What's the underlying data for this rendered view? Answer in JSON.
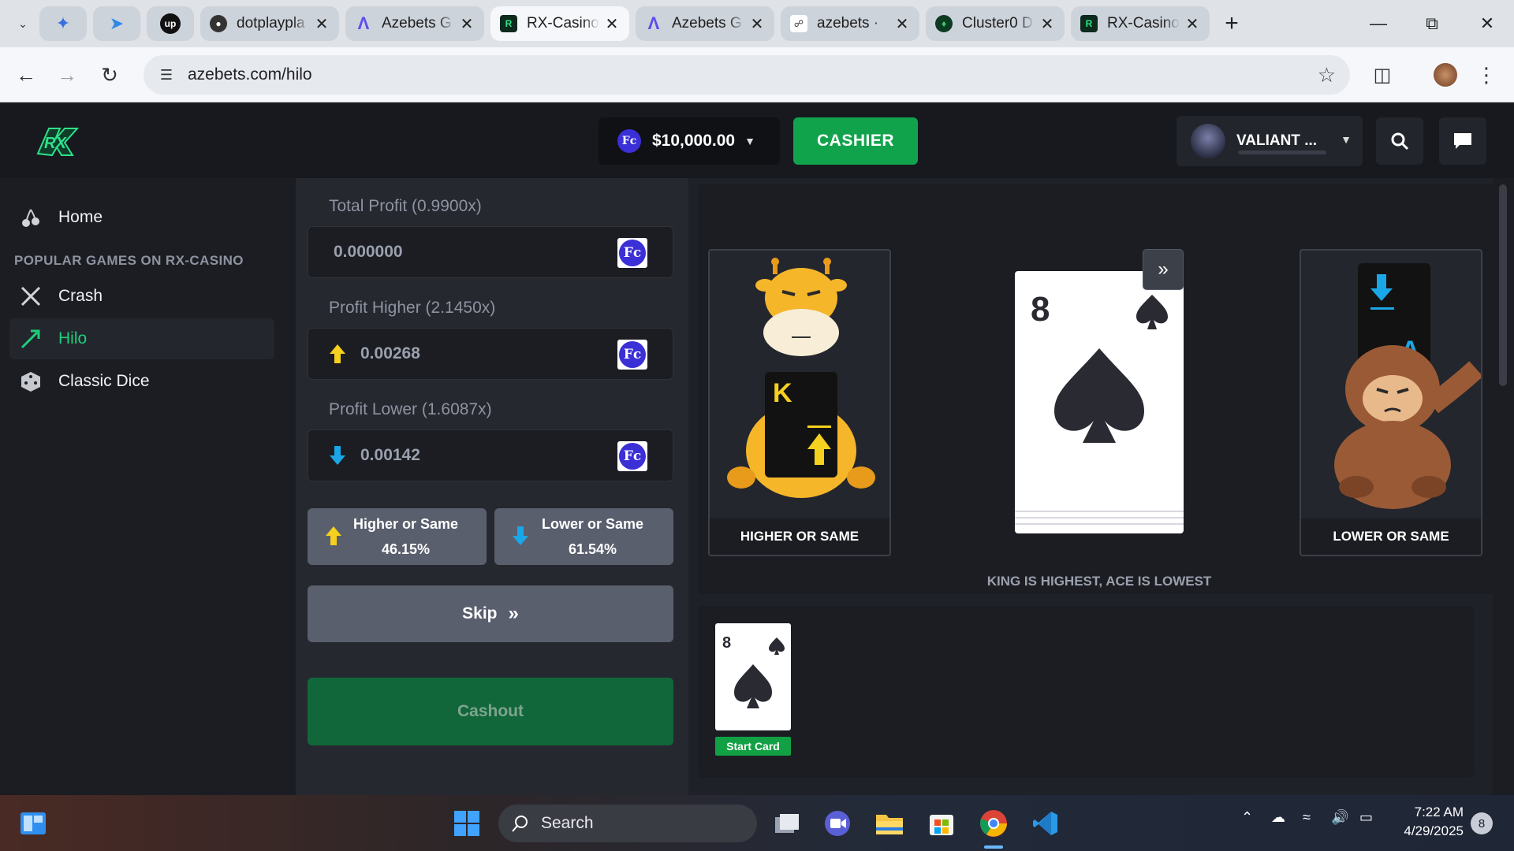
{
  "browser": {
    "tabs": [
      {
        "title": "",
        "icon": "gemini-icon",
        "pinned": true
      },
      {
        "title": "",
        "icon": "bird-icon",
        "pinned": true
      },
      {
        "title": "",
        "icon": "upwork-icon",
        "pinned": true
      },
      {
        "title": "dotplaypla",
        "icon": "github-icon"
      },
      {
        "title": "Azebets G",
        "icon": "azebets-icon"
      },
      {
        "title": "RX-Casino",
        "icon": "rx-icon",
        "active": true
      },
      {
        "title": "Azebets G",
        "icon": "azebets-icon"
      },
      {
        "title": "azebets · ",
        "icon": "link-icon"
      },
      {
        "title": "Cluster0 D",
        "icon": "mongodb-icon"
      },
      {
        "title": "RX-Casino",
        "icon": "rx-icon"
      }
    ],
    "address": "azebets.com/hilo"
  },
  "header": {
    "balance": "$10,000.00",
    "currency_badge": "Fc",
    "cashier_label": "CASHIER",
    "username": "VALIANT ..."
  },
  "sidebar": {
    "home_label": "Home",
    "section_title": "POPULAR GAMES ON RX-CASINO",
    "items": [
      {
        "label": "Crash",
        "icon": "crash-swords-icon"
      },
      {
        "label": "Hilo",
        "icon": "hilo-icon",
        "active": true
      },
      {
        "label": "Classic Dice",
        "icon": "dice-icon"
      }
    ]
  },
  "controls": {
    "total_profit_label": "Total Profit (0.9900x)",
    "total_profit_value": "0.000000",
    "profit_higher_label": "Profit Higher (2.1450x)",
    "profit_higher_value": "0.00268",
    "profit_lower_label": "Profit Lower (1.6087x)",
    "profit_lower_value": "0.00142",
    "higher_btn_label": "Higher or Same",
    "higher_btn_pct": "46.15%",
    "lower_btn_label": "Lower or Same",
    "lower_btn_pct": "61.54%",
    "skip_label": "Skip",
    "cashout_label": "Cashout"
  },
  "game": {
    "higher_caption": "HIGHER OR SAME",
    "lower_caption": "LOWER OR SAME",
    "higher_card_rank": "K",
    "lower_card_rank": "A",
    "current_card_rank": "8",
    "current_card_suit": "spades",
    "hint": "KING IS HIGHEST, ACE IS LOWEST",
    "history": [
      {
        "rank": "8",
        "suit": "spades",
        "label": "Start Card"
      }
    ]
  },
  "taskbar": {
    "search_label": "Search",
    "time": "7:22 AM",
    "date": "4/29/2025",
    "notifications": "8"
  },
  "colors": {
    "accent_green": "#11a34c",
    "active_nav": "#1fce7a",
    "higher_arrow": "#f5d01e",
    "lower_arrow": "#1aa7e8",
    "fc_badge": "#3b2fd6"
  }
}
